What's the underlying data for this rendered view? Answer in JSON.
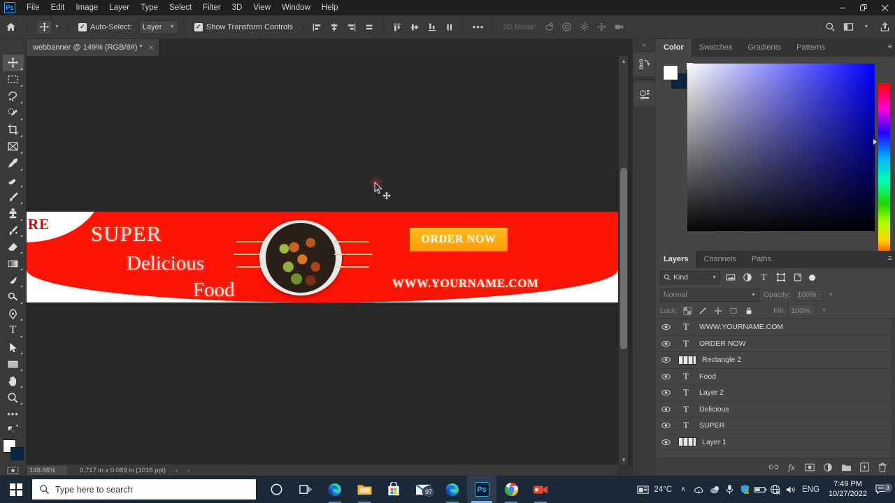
{
  "app": {
    "name": "Adobe Photoshop",
    "logo_text": "Ps"
  },
  "menubar": {
    "items": [
      "File",
      "Edit",
      "Image",
      "Layer",
      "Type",
      "Select",
      "Filter",
      "3D",
      "View",
      "Window",
      "Help"
    ]
  },
  "window_controls": {
    "minimize": "—",
    "restore": "❐",
    "close": "✕"
  },
  "options_bar": {
    "home_icon": "home-icon",
    "tool_icon": "move-tool-icon",
    "auto_select_label": "Auto-Select:",
    "auto_select_checked": true,
    "auto_select_target": "Layer",
    "show_transform_label": "Show Transform Controls",
    "show_transform_checked": true,
    "more_options": "•••",
    "mode_3d_label": "3D Mode:",
    "align_icons": [
      "align-left-edges-icon",
      "align-horizontal-centers-icon",
      "align-right-edges-icon",
      "align-horizontal-distribute-icon"
    ],
    "distribute_icons": [
      "align-top-edges-icon",
      "align-vertical-centers-icon",
      "align-bottom-edges-icon",
      "distribute-vertical-icon"
    ],
    "tools_3d": [
      "orbit-3d-icon",
      "roll-3d-icon",
      "pan-3d-icon",
      "slide-3d-icon",
      "camera-3d-icon"
    ],
    "right_icons": [
      "search-icon",
      "workspace-icon",
      "chevron-down-icon",
      "share-icon"
    ]
  },
  "document": {
    "tab_title": "webbanner @ 149% (RGB/8#) *",
    "close_glyph": "×"
  },
  "toolbar": {
    "tools": [
      {
        "name": "move-tool",
        "glyph": "move",
        "active": true
      },
      {
        "name": "rectangular-marquee-tool",
        "glyph": "marquee"
      },
      {
        "name": "lasso-tool",
        "glyph": "lasso"
      },
      {
        "name": "object-selection-tool",
        "glyph": "quickselect"
      },
      {
        "name": "crop-tool",
        "glyph": "crop"
      },
      {
        "name": "frame-tool",
        "glyph": "frame"
      },
      {
        "name": "eyedropper-tool",
        "glyph": "eyedropper"
      },
      {
        "name": "spot-healing-brush-tool",
        "glyph": "healing"
      },
      {
        "name": "brush-tool",
        "glyph": "brush"
      },
      {
        "name": "clone-stamp-tool",
        "glyph": "stamp"
      },
      {
        "name": "history-brush-tool",
        "glyph": "historybrush"
      },
      {
        "name": "eraser-tool",
        "glyph": "eraser"
      },
      {
        "name": "gradient-tool",
        "glyph": "gradient"
      },
      {
        "name": "blur-tool",
        "glyph": "blur"
      },
      {
        "name": "dodge-tool",
        "glyph": "dodge"
      },
      {
        "name": "pen-tool",
        "glyph": "pen"
      },
      {
        "name": "type-tool",
        "glyph": "type"
      },
      {
        "name": "path-selection-tool",
        "glyph": "pathselect"
      },
      {
        "name": "rectangle-tool",
        "glyph": "rectangle"
      },
      {
        "name": "hand-tool",
        "glyph": "hand"
      },
      {
        "name": "zoom-tool",
        "glyph": "zoom"
      }
    ],
    "more_tools": "•••",
    "foreground_color": "#ffffff",
    "background_color": "#0b2545",
    "quick_mask_icon": "quick-mask-icon",
    "screen_mode_icon": "screen-mode-icon"
  },
  "canvas": {
    "background_color": "#282828",
    "banner": {
      "red": "#fb1405",
      "edge_text": "RE",
      "headline_1": "SUPER",
      "headline_2": "Delicious",
      "headline_3": "Food",
      "cta_label": "ORDER NOW",
      "cta_color": "#ffa913",
      "website": "WWW.YOURNAME.COM"
    },
    "cursor": "move-tool-cursor"
  },
  "status_bar": {
    "zoom": "148.66%",
    "doc_size": "0.717 in x 0.089 in (1016 ppi)",
    "next_glyph": "›",
    "prev_glyph": "‹"
  },
  "mini_dock": {
    "collapse_glyph": "«",
    "buttons": [
      "history-panel-icon",
      "libraries-panel-icon"
    ]
  },
  "color_panel": {
    "tabs": [
      "Color",
      "Swatches",
      "Gradients",
      "Patterns"
    ],
    "active_tab": "Color",
    "menu_glyph": "≡",
    "foreground": "#ffffff",
    "background": "#0b2545"
  },
  "layers_panel": {
    "tabs": [
      "Layers",
      "Channels",
      "Paths"
    ],
    "active_tab": "Layers",
    "menu_glyph": "≡",
    "filter_label": "Kind",
    "filter_icons": [
      "filter-pixel-icon",
      "filter-adjustment-icon",
      "filter-type-icon",
      "filter-shape-icon",
      "filter-smart-object-icon"
    ],
    "blend_mode": "Normal",
    "opacity_label": "Opacity:",
    "opacity_value": "100%",
    "lock_label": "Lock:",
    "lock_icons": [
      "lock-transparent-pixels-icon",
      "lock-image-pixels-icon",
      "lock-position-icon",
      "lock-artboard-nesting-icon",
      "lock-all-icon"
    ],
    "fill_label": "Fill:",
    "fill_value": "100%",
    "layers": [
      {
        "name": "WWW.YOURNAME.COM",
        "type": "text",
        "visible": true
      },
      {
        "name": "ORDER NOW",
        "type": "text",
        "visible": true
      },
      {
        "name": "Rectangle 2",
        "type": "shape",
        "visible": true
      },
      {
        "name": "Food",
        "type": "text",
        "visible": true
      },
      {
        "name": "Layer 2",
        "type": "text",
        "visible": true
      },
      {
        "name": "Delicious",
        "type": "text",
        "visible": true
      },
      {
        "name": "SUPER",
        "type": "text",
        "visible": true
      },
      {
        "name": "Layer 1",
        "type": "image",
        "visible": true
      }
    ],
    "footer_icons": [
      "link-layers-icon",
      "layer-style-fx-icon",
      "add-layer-mask-icon",
      "new-adjustment-layer-icon",
      "new-group-icon",
      "new-layer-icon",
      "delete-layer-icon"
    ],
    "fx_label": "fx"
  },
  "taskbar": {
    "start_icon": "windows-start-icon",
    "search_placeholder": "Type here to search",
    "search_icon": "search-icon",
    "apps": [
      {
        "name": "cortana",
        "label": "Cortana"
      },
      {
        "name": "task-view",
        "label": "Task View"
      },
      {
        "name": "microsoft-edge",
        "label": "Microsoft Edge"
      },
      {
        "name": "file-explorer",
        "label": "File Explorer"
      },
      {
        "name": "microsoft-store",
        "label": "Microsoft Store"
      },
      {
        "name": "mail",
        "label": "Mail",
        "badge": "97"
      },
      {
        "name": "microsoft-edge-2",
        "label": "Microsoft Edge"
      },
      {
        "name": "photoshop",
        "label": "Adobe Photoshop",
        "active": true
      },
      {
        "name": "google-chrome",
        "label": "Google Chrome"
      },
      {
        "name": "camtasia-recorder",
        "label": "Camtasia Recorder"
      }
    ],
    "tray": {
      "news_weather_icon": "news-weather-icon",
      "temperature": "24°C",
      "show_hidden_glyph": "∧",
      "icons": [
        "onedrive-icon",
        "network-share-icon",
        "microphone-icon",
        "security-warning-icon",
        "battery-icon",
        "network-globe-icon",
        "volume-icon"
      ],
      "language": "ENG",
      "time": "7:49 PM",
      "date": "10/27/2022",
      "notification_icon": "action-center-icon",
      "notification_count": "3"
    }
  }
}
